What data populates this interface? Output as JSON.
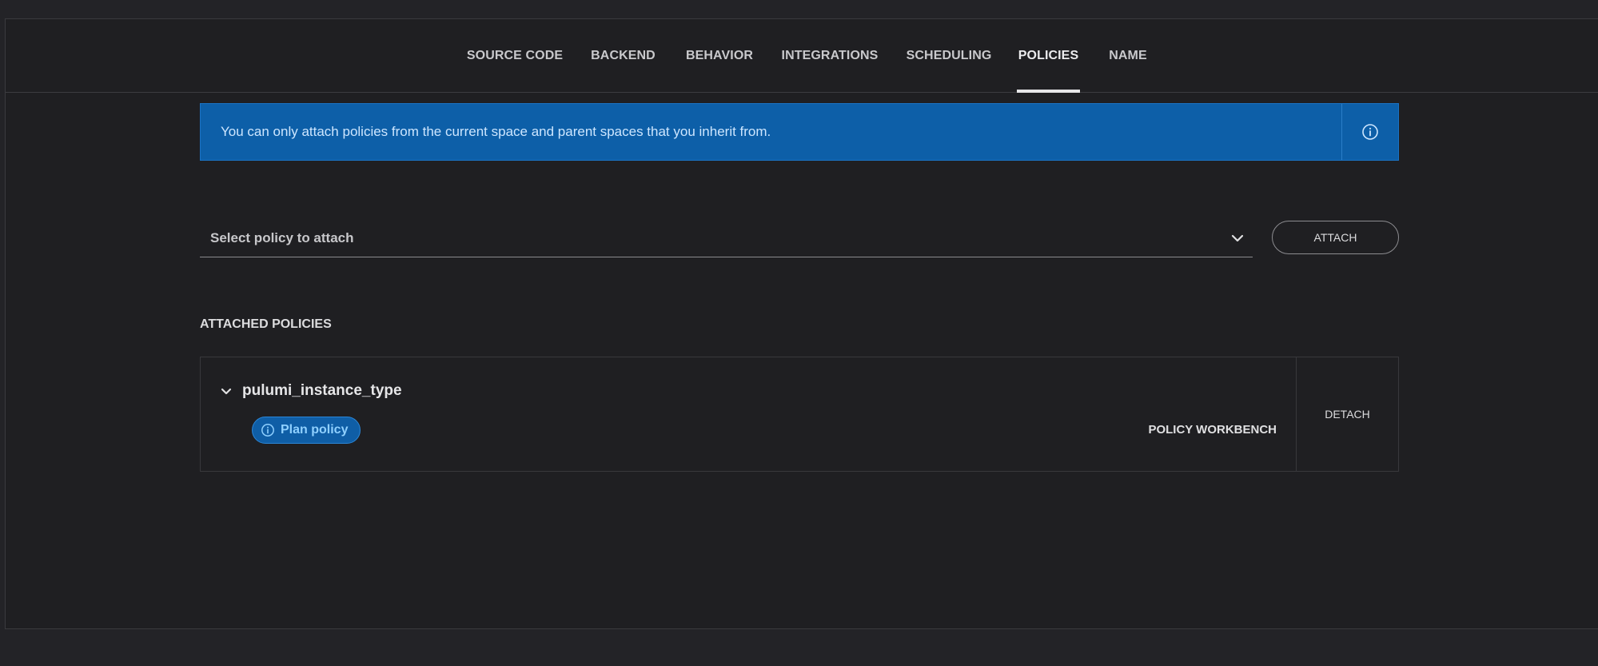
{
  "tabs": [
    {
      "label": "SOURCE CODE"
    },
    {
      "label": "BACKEND"
    },
    {
      "label": "BEHAVIOR"
    },
    {
      "label": "INTEGRATIONS"
    },
    {
      "label": "SCHEDULING"
    },
    {
      "label": "POLICIES",
      "active": true
    },
    {
      "label": "NAME"
    }
  ],
  "banner": {
    "text": "You can only attach policies from the current space and parent spaces that you inherit from.",
    "icon": "info-icon",
    "background_color": "#0d5fa8"
  },
  "select": {
    "placeholder": "Select policy to attach",
    "icon": "chevron-down-icon"
  },
  "attach_button": {
    "label": "ATTACH"
  },
  "attached_section": {
    "title": "ATTACHED POLICIES",
    "policies": [
      {
        "name": "pulumi_instance_type",
        "badge": {
          "label": "Plan policy",
          "icon": "info-icon"
        },
        "link_label": "POLICY WORKBENCH",
        "detach_label": "DETACH"
      }
    ]
  },
  "colors": {
    "page_background": "#1f1f22",
    "accent_blue": "#0d5fa8",
    "badge_text": "#8fd0ff"
  }
}
